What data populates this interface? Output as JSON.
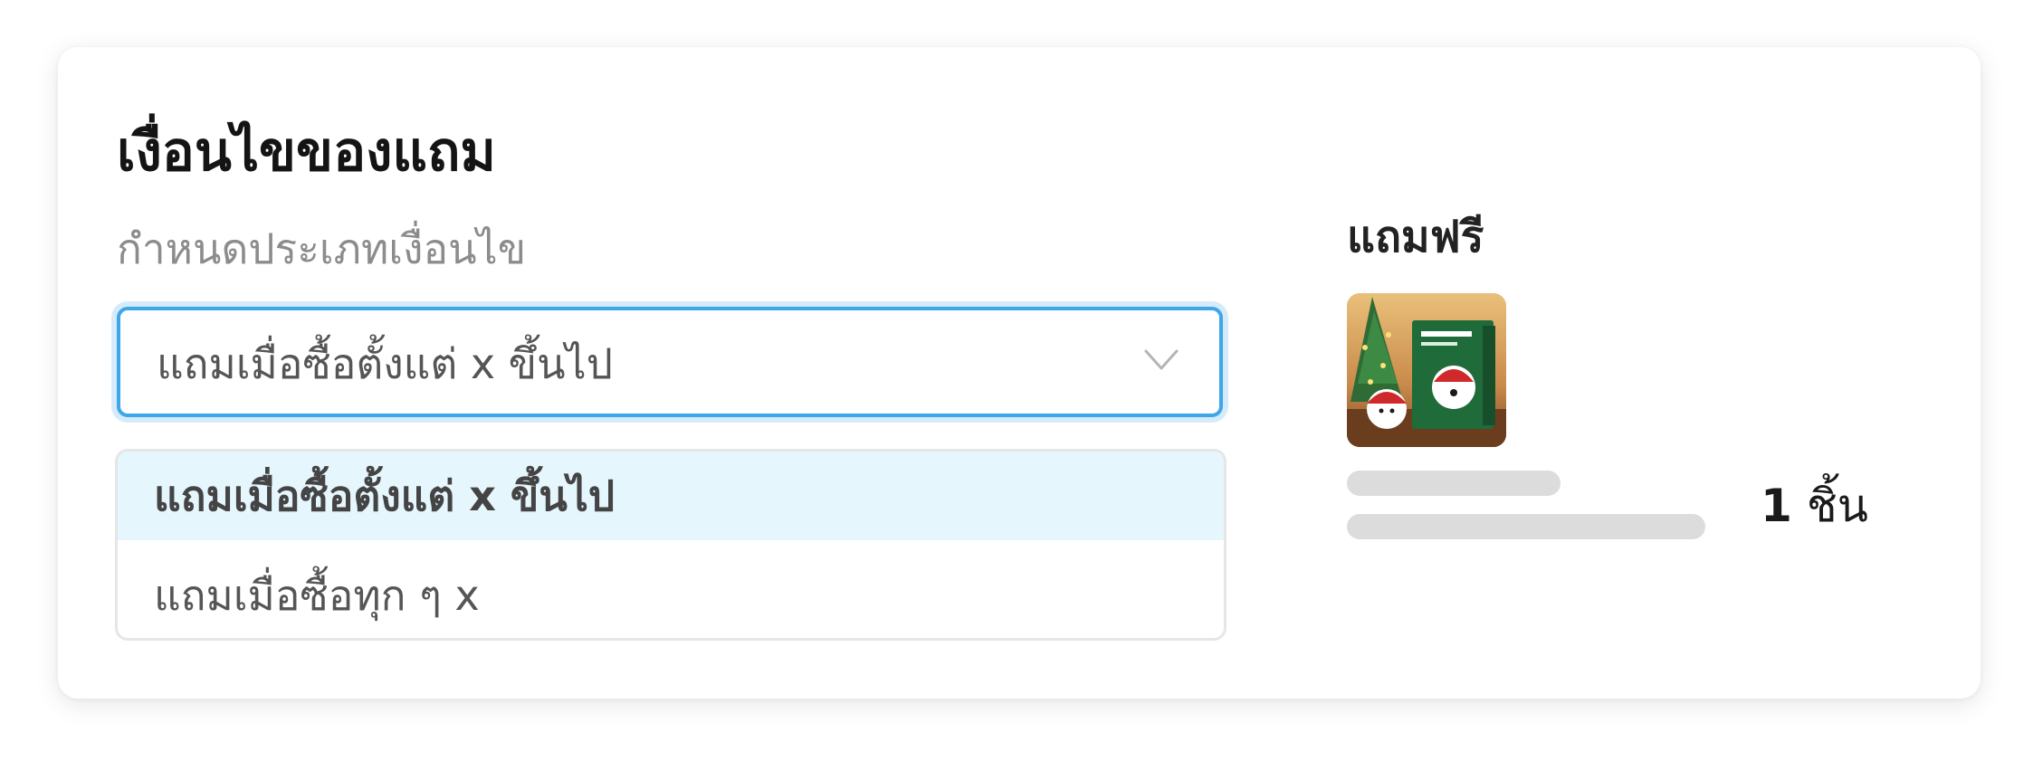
{
  "section": {
    "title": "เงื่อนไขของแถม",
    "field_label": "กำหนดประเภทเงื่อนไข"
  },
  "select": {
    "value": "แถมเมื่อซื้อตั้งแต่ x ขึ้นไป",
    "icon": "chevron-down-icon",
    "accent_color": "#3ea6ea"
  },
  "dropdown": {
    "options": [
      {
        "label": "แถมเมื่อซื้อตั้งแต่ x ขึ้นไป",
        "selected": true
      },
      {
        "label": "แถมเมื่อซื้อทุก ๆ x",
        "selected": false
      }
    ],
    "highlight_color": "#e6f6fd"
  },
  "free_gift": {
    "label": "แถมฟรี",
    "quantity_number": "1",
    "quantity_unit": "ชิ้น"
  }
}
